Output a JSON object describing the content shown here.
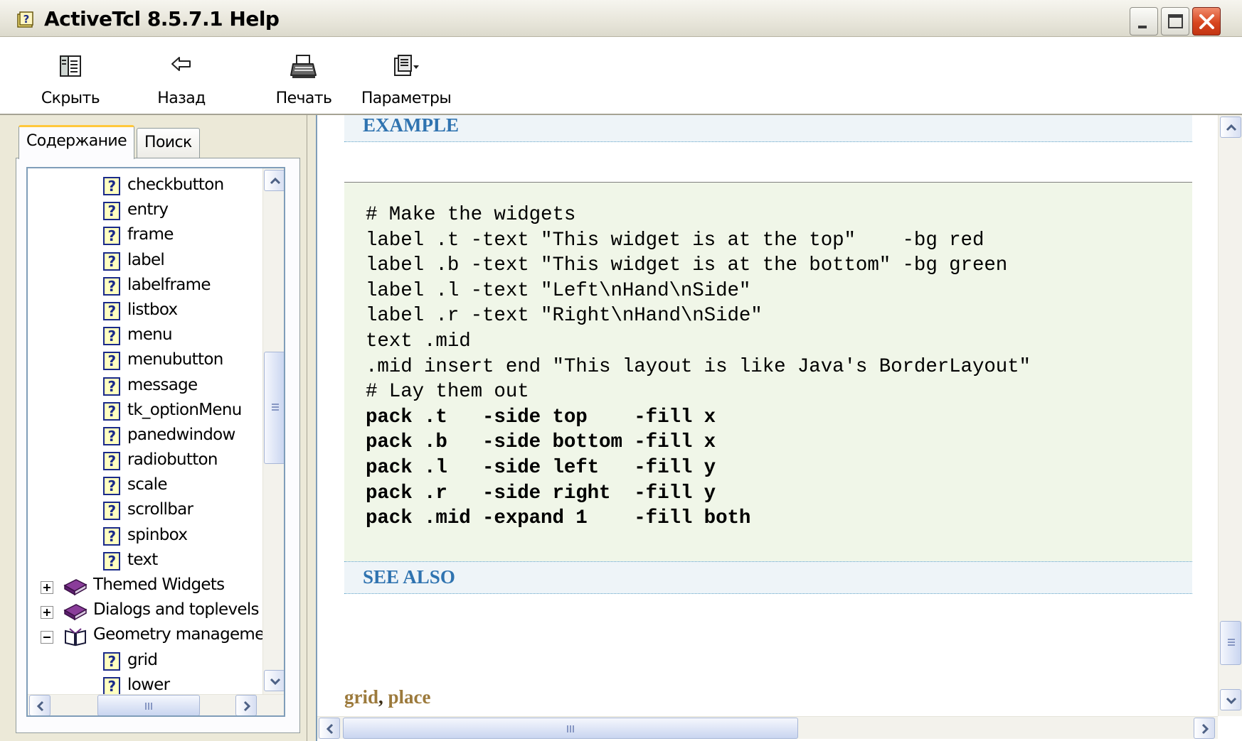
{
  "window": {
    "title": "ActiveTcl 8.5.7.1 Help"
  },
  "toolbar": {
    "hide_label": "Скрыть",
    "back_label": "Назад",
    "print_label": "Печать",
    "options_label": "Параметры"
  },
  "tabs": {
    "contents_label": "Содержание",
    "search_label": "Поиск"
  },
  "tree": {
    "items": [
      {
        "label": "checkbutton"
      },
      {
        "label": "entry"
      },
      {
        "label": "frame"
      },
      {
        "label": "label"
      },
      {
        "label": "labelframe"
      },
      {
        "label": "listbox"
      },
      {
        "label": "menu"
      },
      {
        "label": "menubutton"
      },
      {
        "label": "message"
      },
      {
        "label": "tk_optionMenu"
      },
      {
        "label": "panedwindow"
      },
      {
        "label": "radiobutton"
      },
      {
        "label": "scale"
      },
      {
        "label": "scrollbar"
      },
      {
        "label": "spinbox"
      },
      {
        "label": "text"
      },
      {
        "label": "Themed Widgets"
      },
      {
        "label": "Dialogs and toplevels"
      },
      {
        "label": "Geometry manageme"
      },
      {
        "label": "grid"
      },
      {
        "label": "lower"
      }
    ],
    "question_glyph": "?"
  },
  "content": {
    "example_heading": "EXAMPLE",
    "code_lines": [
      "# Make the widgets",
      "label .t -text \"This widget is at the top\"    -bg red",
      "label .b -text \"This widget is at the bottom\" -bg green",
      "label .l -text \"Left\\nHand\\nSide\"",
      "label .r -text \"Right\\nHand\\nSide\"",
      "text .mid",
      ".mid insert end \"This layout is like Java's BorderLayout\"",
      "# Lay them out",
      "pack .t   -side top    -fill x",
      "pack .b   -side bottom -fill x",
      "pack .l   -side left   -fill y",
      "pack .r   -side right  -fill y",
      "pack .mid -expand 1    -fill both"
    ],
    "see_also_heading": "SEE ALSO",
    "see_also_links": [
      "grid",
      "place"
    ],
    "see_also_separator": ", "
  },
  "colors": {
    "heading_text": "#2f73b0",
    "heading_bg": "#eef4f8",
    "code_bg": "#f0f6e8",
    "link": "#9c7a3c"
  },
  "icons": {
    "title": "help-book-icon",
    "hide": "hide-pane-icon",
    "back": "back-arrow-icon",
    "print": "printer-icon",
    "options": "options-icon"
  }
}
